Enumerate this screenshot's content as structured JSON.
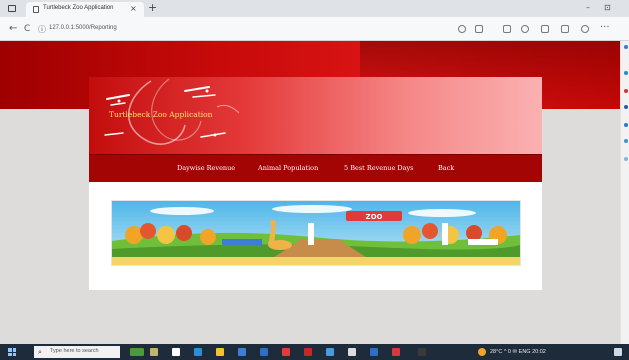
{
  "browser": {
    "tab_title": "Turtlebeck Zoo Application",
    "tab_close": "×",
    "new_tab": "+",
    "url": "127.0.0.1:5000/Reporting",
    "window_controls": [
      "–",
      "⊡"
    ]
  },
  "nav": {
    "back": "←",
    "refresh": "C",
    "info": "ⓘ",
    "more": "···"
  },
  "site": {
    "app_name": "Turtlebeck Zoo Application",
    "menu": [
      "Daywise Revenue",
      "Animal Population",
      "5 Best Revenue Days",
      "Back"
    ],
    "banner_sign": "ZOO"
  },
  "taskbar": {
    "search_icon": "⌕",
    "search_placeholder": "Type here to search",
    "tray_text": "28°C  ^ 0 ✉ ENG  20:02"
  },
  "colors": {
    "page_banner": "#c70a0a",
    "header_start": "#c30d0d",
    "header_end": "#fbb1b1",
    "menu_bar": "#a30404",
    "app_name_text": "#ffe36b",
    "taskbar": "#1d2b3a"
  },
  "icons": [
    "window-icon",
    "tab-favicon",
    "back-arrow-icon",
    "refresh-icon",
    "info-icon",
    "star-icon",
    "extensions-icon",
    "collections-icon",
    "profile-icon",
    "windows-start-icon",
    "search-icon"
  ]
}
